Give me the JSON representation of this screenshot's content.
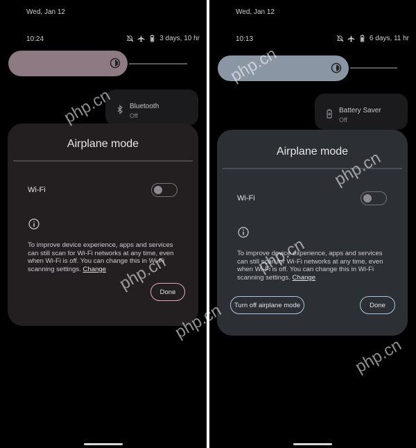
{
  "left": {
    "date": "Wed, Jan 12",
    "time": "10:24",
    "battery_text": "3 days, 10 hr",
    "tile": {
      "name": "Bluetooth",
      "state": "Off",
      "icon": "bluetooth-icon"
    },
    "dialog": {
      "title": "Airplane mode",
      "wifi_label": "Wi-Fi",
      "wifi_on": false,
      "body": "To improve device experience, apps and services can still scan for Wi-Fi networks at any time, even when Wi-Fi is off. You can change this in Wi-Fi scanning settings.",
      "link": "Change",
      "done": "Done"
    },
    "colors": {
      "brightness": "#8e7a83",
      "dialog": "#231f20",
      "accent": "#e7a7b6"
    }
  },
  "right": {
    "date": "Wed, Jan 12",
    "time": "10:13",
    "battery_text": "6 days, 11 hr",
    "tile": {
      "name": "Battery Saver",
      "state": "Off",
      "icon": "battery-saver-icon"
    },
    "dialog": {
      "title": "Airplane mode",
      "wifi_label": "Wi-Fi",
      "wifi_on": false,
      "body": "To improve device experience, apps and services can still scan for Wi-Fi networks at any time, even when Wi-Fi is off. You can change this in Wi-Fi scanning settings.",
      "link": "Change",
      "turn_off": "Turn off airplane mode",
      "done": "Done"
    },
    "colors": {
      "brightness": "#8a96a3",
      "dialog": "#2c2f33",
      "accent": "#a9c7e0"
    }
  },
  "watermark": "php.cn"
}
